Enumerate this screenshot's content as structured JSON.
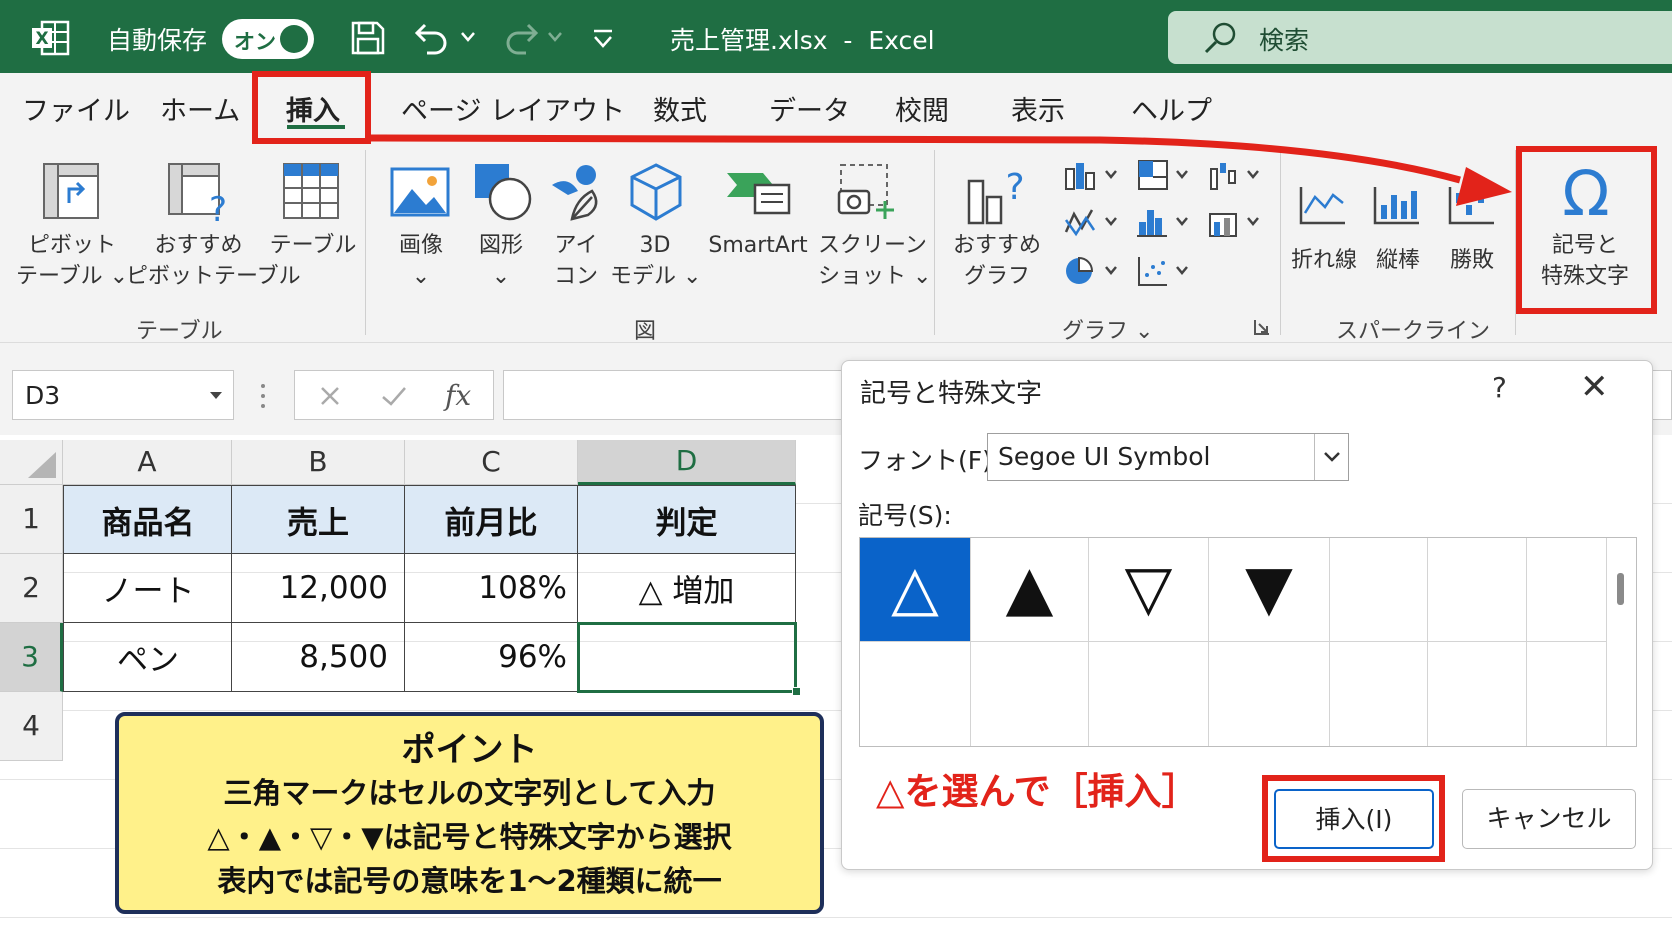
{
  "titlebar": {
    "autosave_label": "自動保存",
    "autosave_state": "オン",
    "doc_title": "売上管理.xlsx  -  Excel",
    "search_placeholder": "検索"
  },
  "tabs": [
    "ファイル",
    "ホーム",
    "挿入",
    "ページ レイアウト",
    "数式",
    "データ",
    "校閲",
    "表示",
    "ヘルプ"
  ],
  "ribbon": {
    "pivot_line1": "ピボット",
    "pivot_line2": "テーブル ⌄",
    "recpivot_line1": "おすすめ",
    "recpivot_line2": "ピボットテーブル",
    "table": "テーブル",
    "group_table": "テーブル",
    "picture_line1": "画像",
    "picture_line2": "⌄",
    "shapes_line1": "図形",
    "shapes_line2": "⌄",
    "icons_line1": "アイ",
    "icons_line2": "コン",
    "models_line1": "3D",
    "models_line2": "モデル ⌄",
    "smartart": "SmartArt",
    "screenshot_line1": "スクリーン",
    "screenshot_line2": "ショット ⌄",
    "group_illust": "図",
    "recchart_line1": "おすすめ",
    "recchart_line2": "グラフ",
    "group_chart": "グラフ ⌄",
    "spark_line": "折れ線",
    "spark_column": "縦棒",
    "spark_winloss": "勝敗",
    "group_spark": "スパークライン",
    "symbol_line1": "記号と",
    "symbol_line2": "特殊文字"
  },
  "formula_bar": {
    "name_box": "D3",
    "fx": "fx",
    "value": ""
  },
  "sheet": {
    "columns": [
      "A",
      "B",
      "C",
      "D"
    ],
    "rows": [
      "1",
      "2",
      "3",
      "4"
    ],
    "headers": [
      "商品名",
      "売上",
      "前月比",
      "判定"
    ],
    "data": [
      [
        "ノート",
        "12,000",
        "108%",
        "△ 増加"
      ],
      [
        "ペン",
        "8,500",
        "96%",
        ""
      ]
    ]
  },
  "note": {
    "title": "ポイント",
    "line1": "三角マークはセルの文字列として入力",
    "line2": "△・▲・▽・▼は記号と特殊文字から選択",
    "line3": "表内では記号の意味を1～2種類に統一"
  },
  "dialog": {
    "title": "記号と特殊文字",
    "help": "?",
    "close": "✕",
    "font_label": "フォント(F):",
    "font_value": "Segoe UI Symbol",
    "symbol_label": "記号(S):",
    "symbols": [
      "△",
      "▲",
      "▽",
      "▼"
    ],
    "hint": "△を選んで［挿入］",
    "insert_button": "挿入(I)",
    "cancel_button": "キャンセル"
  },
  "colors": {
    "excel_green": "#1f6e43",
    "highlight_red": "#e2231a",
    "selection_blue": "#0a63c9",
    "note_yellow": "#fff18a"
  }
}
